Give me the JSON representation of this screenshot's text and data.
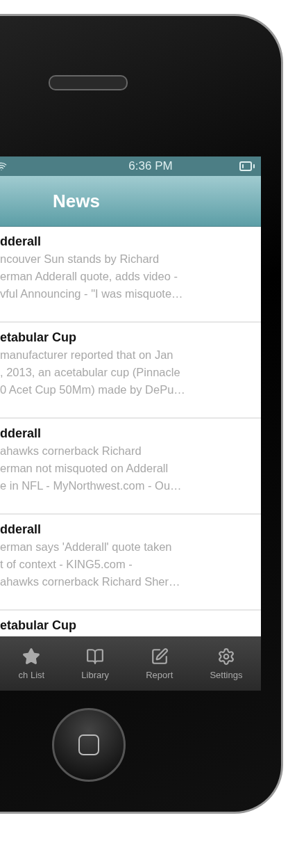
{
  "status_bar": {
    "time": "6:36 PM"
  },
  "nav_bar": {
    "title": "News"
  },
  "articles": [
    {
      "title": "dderall",
      "snippet": [
        "ncouver Sun stands by Richard",
        "erman Adderall quote, adds video -",
        "vful Announcing - \"I was misquote…"
      ]
    },
    {
      "title": "etabular Cup",
      "snippet": [
        "manufacturer reported that on Jan",
        ", 2013, an acetabular cup (Pinnacle",
        "0 Acet Cup 50Mm) made by DePu…"
      ]
    },
    {
      "title": "dderall",
      "snippet": [
        "ahawks cornerback Richard",
        "erman not misquoted on Adderall",
        "e in NFL - MyNorthwest.com - Ou…"
      ]
    },
    {
      "title": "dderall",
      "snippet": [
        "erman says 'Adderall' quote taken",
        "t of context - KING5.com -",
        "ahawks cornerback Richard Sher…"
      ]
    },
    {
      "title": "etabular Cup"
    }
  ],
  "tab_bar": [
    {
      "kind": "star",
      "label": "ch List"
    },
    {
      "kind": "book",
      "label": "Library"
    },
    {
      "kind": "compose",
      "label": "Report"
    },
    {
      "kind": "gear",
      "label": "Settings"
    }
  ]
}
